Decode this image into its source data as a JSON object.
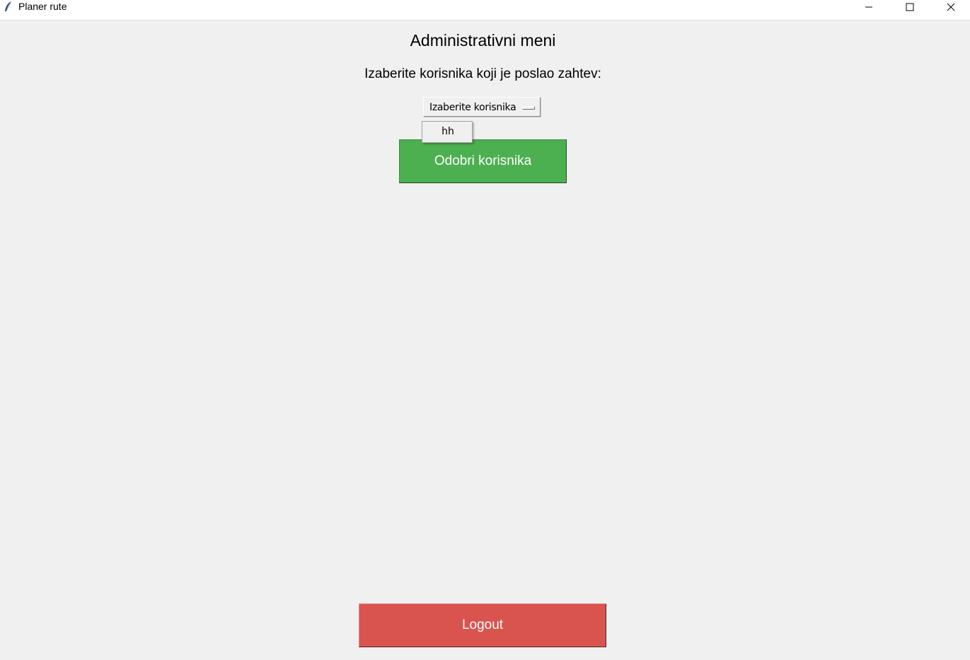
{
  "window": {
    "title": "Planer rute",
    "icon": "feather-icon",
    "controls": [
      "minimize-icon",
      "maximize-icon",
      "close-icon"
    ]
  },
  "main": {
    "heading": "Administrativni meni",
    "subtitle": "Izaberite korisnika koji je poslao zahtev:",
    "user_select": {
      "selected": "Izaberite korisnika",
      "options": [
        "hh"
      ]
    },
    "approve_button": "Odobri korisnika",
    "logout_button": "Logout"
  },
  "colors": {
    "approve": "#4caf50",
    "logout": "#d9534f",
    "background": "#f0f0f0"
  }
}
